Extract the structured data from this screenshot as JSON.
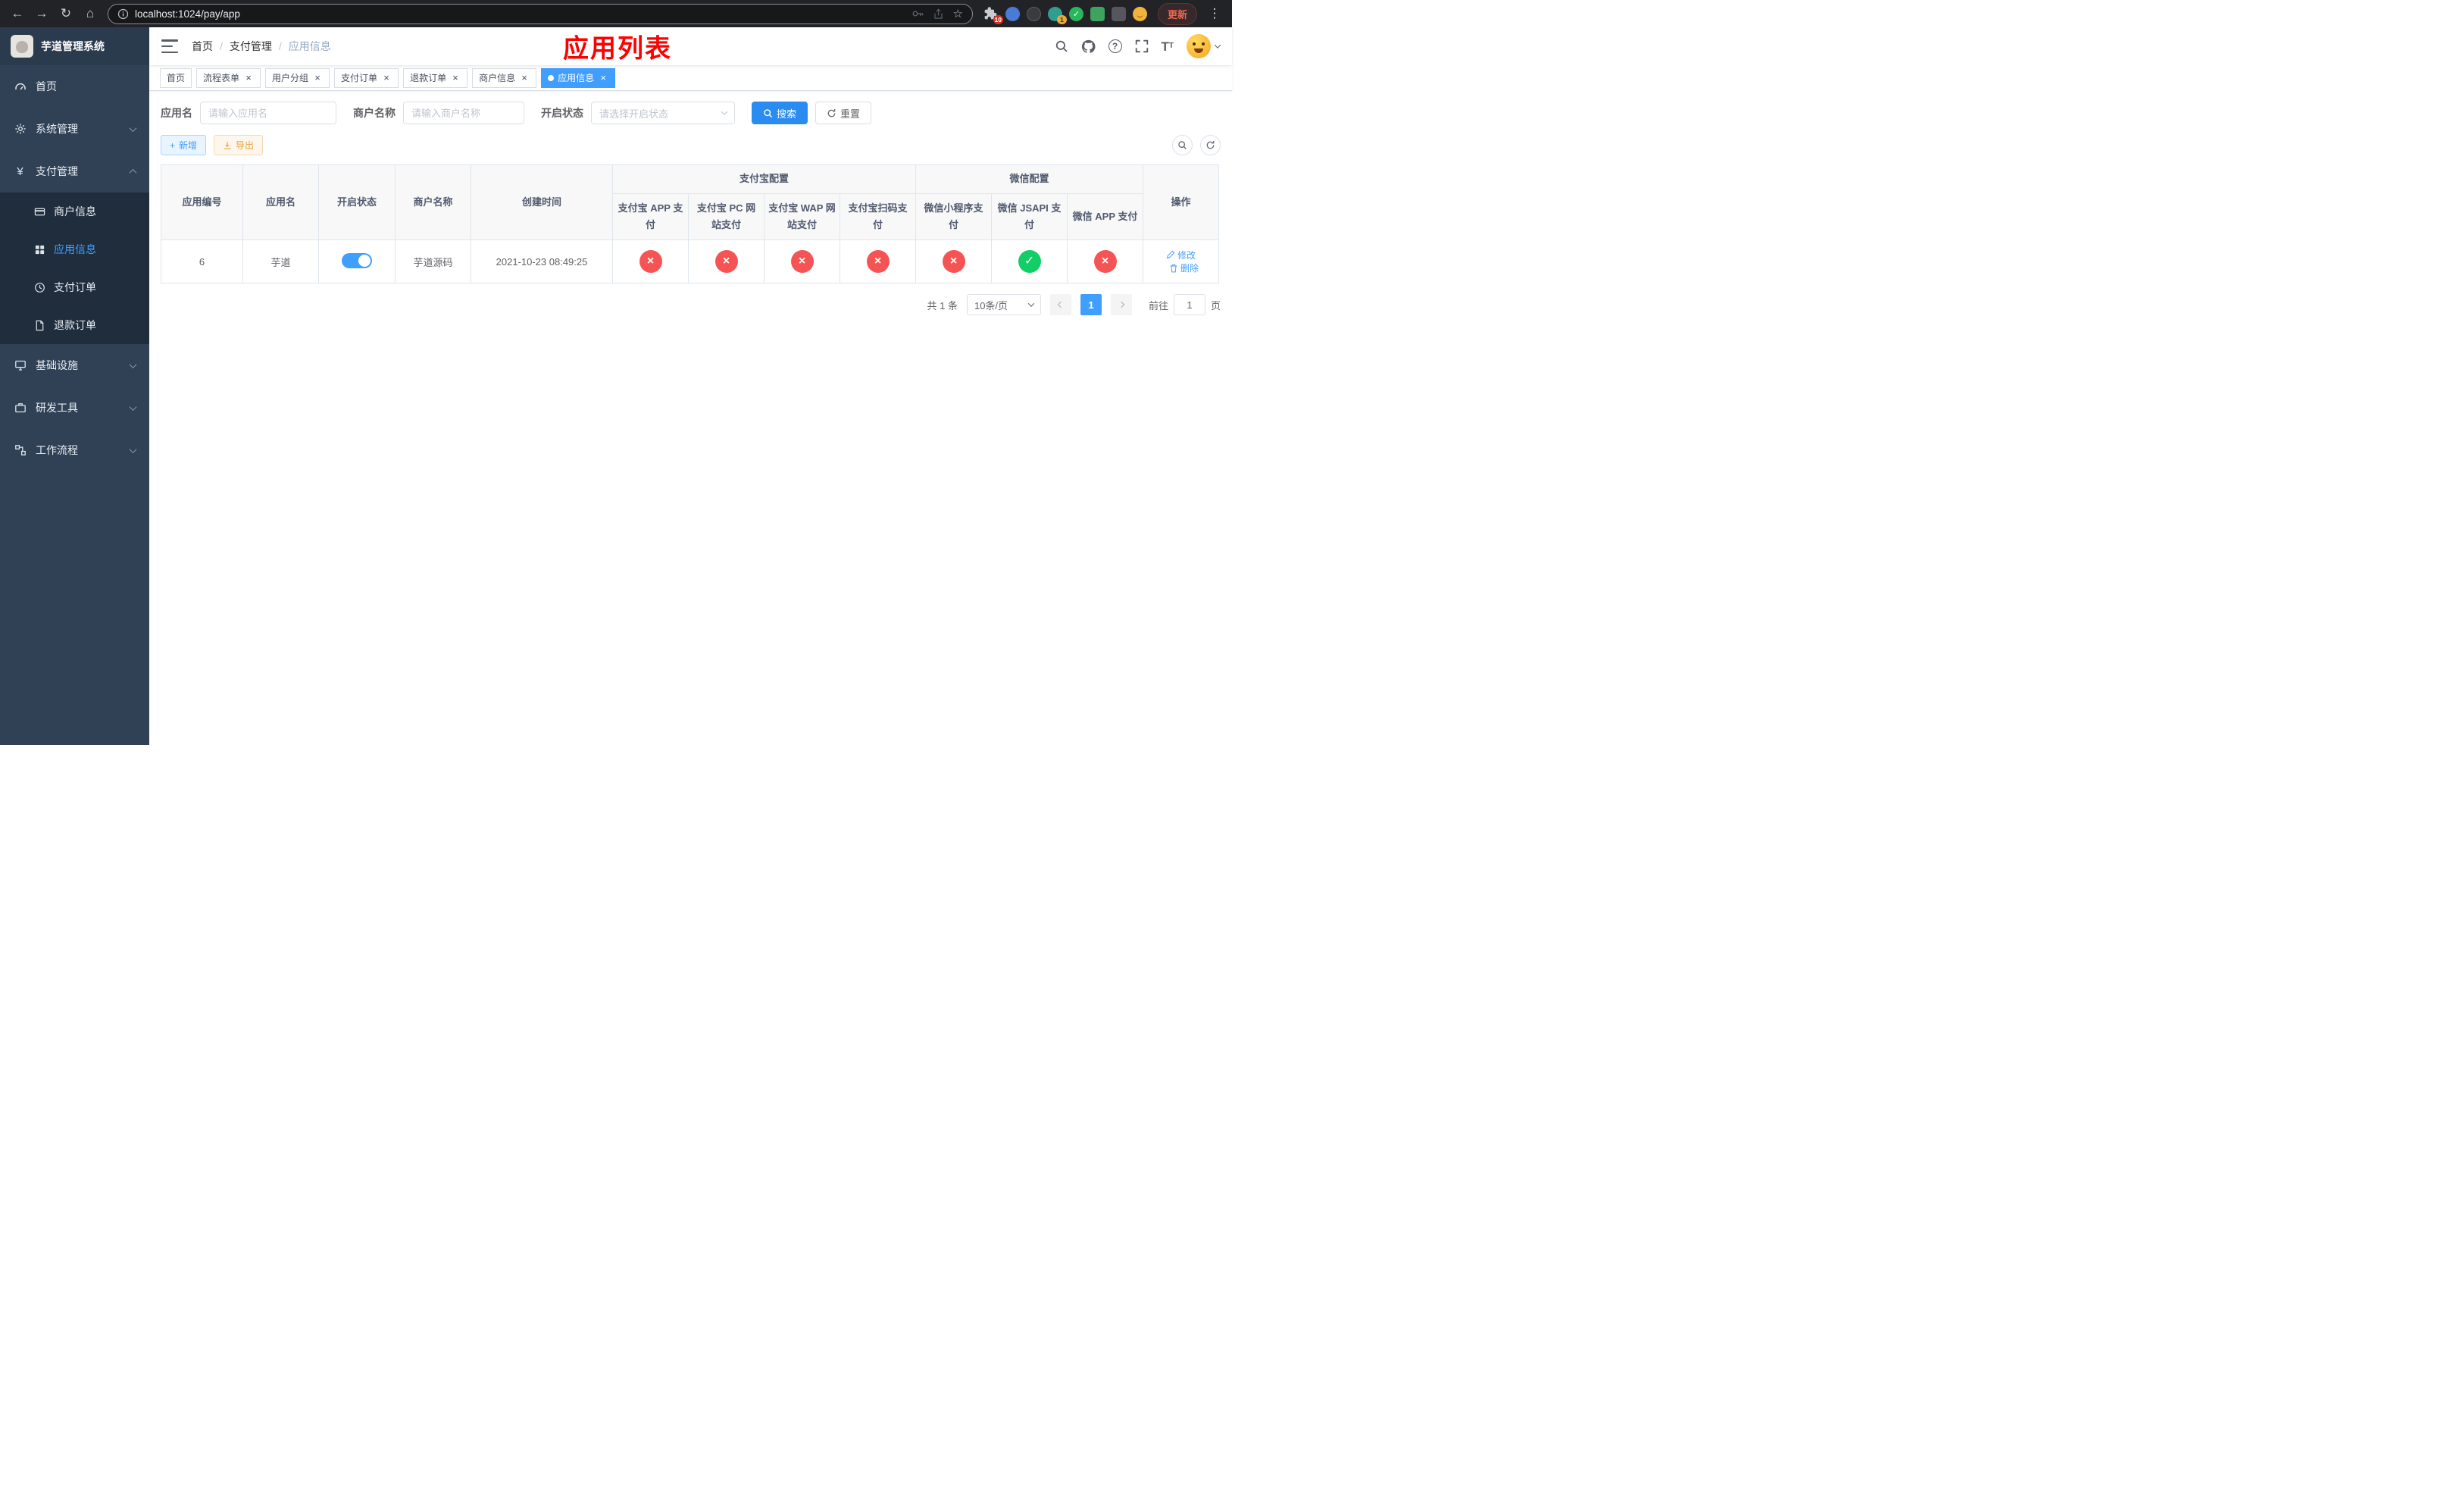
{
  "browser": {
    "url": "localhost:1024/pay/app",
    "update_label": "更新",
    "extensions_badge": "10",
    "extension_badge_2": "1"
  },
  "icons": {
    "back": "←",
    "forward": "→",
    "reload": "↻",
    "home": "⌂",
    "star": "☆",
    "kebab": "⋮",
    "plus": "+",
    "close": "×",
    "check": "✓",
    "cross": "×",
    "yen": "¥",
    "question": "?"
  },
  "sidebar": {
    "logo_title": "芋道管理系统",
    "item_home": "首页",
    "item_system": "系统管理",
    "item_payment": "支付管理",
    "sub_merchant": "商户信息",
    "sub_app_info": "应用信息",
    "sub_pay_order": "支付订单",
    "sub_refund_order": "退款订单",
    "item_infra": "基础设施",
    "item_devtools": "研发工具",
    "item_workflow": "工作流程"
  },
  "header": {
    "breadcrumb": [
      "首页",
      "支付管理",
      "应用信息"
    ],
    "page_title": "应用列表"
  },
  "tabs": [
    {
      "label": "首页"
    },
    {
      "label": "流程表单"
    },
    {
      "label": "用户分组"
    },
    {
      "label": "支付订单"
    },
    {
      "label": "退款订单"
    },
    {
      "label": "商户信息"
    },
    {
      "label": "应用信息"
    }
  ],
  "filters": {
    "app_name_label": "应用名",
    "app_name_placeholder": "请输入应用名",
    "merchant_label": "商户名称",
    "merchant_placeholder": "请输入商户名称",
    "status_label": "开启状态",
    "status_placeholder": "请选择开启状态",
    "search_label": "搜索",
    "reset_label": "重置"
  },
  "toolbar": {
    "add_label": "新增",
    "export_label": "导出"
  },
  "table": {
    "group_alipay": "支付宝配置",
    "group_wechat": "微信配置",
    "col_app_id": "应用编号",
    "col_app_name": "应用名",
    "col_status": "开启状态",
    "col_merchant": "商户名称",
    "col_created": "创建时间",
    "col_alipay_app": "支付宝 APP 支付",
    "col_alipay_pc": "支付宝 PC 网站支付",
    "col_alipay_wap": "支付宝 WAP 网站支付",
    "col_alipay_qr": "支付宝扫码支付",
    "col_wx_mini": "微信小程序支付",
    "col_wx_jsapi": "微信 JSAPI 支付",
    "col_wx_app": "微信 APP 支付",
    "col_actions": "操作",
    "rows": [
      {
        "app_id": "6",
        "app_name": "芋道",
        "status_on": true,
        "merchant": "芋道源码",
        "created": "2021-10-23 08:49:25",
        "alipay_app": "disabled",
        "alipay_pc": "disabled",
        "alipay_wap": "disabled",
        "alipay_qr": "disabled",
        "wx_mini": "disabled",
        "wx_jsapi": "enabled",
        "wx_app": "disabled",
        "edit_label": "修改",
        "delete_label": "删除"
      }
    ]
  },
  "pagination": {
    "total_text": "共 1 条",
    "page_size_text": "10条/页",
    "current_page": "1",
    "goto_prefix": "前往",
    "goto_value": "1",
    "goto_suffix": "页"
  },
  "colors": {
    "accent_blue": "#409eff",
    "danger_red": "#f65454",
    "success_green": "#12ce66",
    "title_red": "#ff0000",
    "warning_yellow": "#e6a23c",
    "sidebar_bg": "#304156",
    "submenu_bg": "#1f2d3d"
  }
}
